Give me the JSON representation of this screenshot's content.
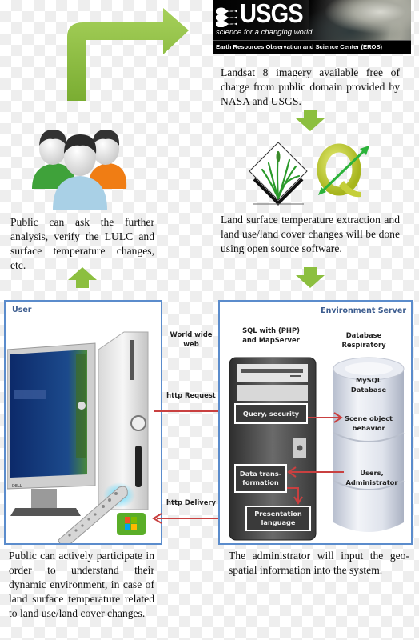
{
  "usgs_banner": {
    "wordmark": "USGS",
    "tagline": "science for a changing world",
    "center_name": "Earth Resources Observation and Science Center (EROS)"
  },
  "steps": {
    "landsat_text": "Landsat 8 imagery available free of charge from public domain provided by NASA and USGS.",
    "software_text": "Land surface temperature extraction and land use/land cover changes will be done using open source software.",
    "public_ask_text": "Public can ask the further analysis, verify the LULC and surface temperature changes, etc.",
    "public_participate_text": "Public can actively participate in order to understand their dynamic environment, in case of  land surface temperature related to land use/land cover changes.",
    "admin_text": "The administrator will input the geo-spatial information into the system."
  },
  "icons": {
    "users": "users-group-icon",
    "grass": "grass-gis-logo-icon",
    "qgis": "qgis-logo-icon",
    "computer": "desktop-computer-icon",
    "windows": "windows-media-center-icon",
    "server": "server-tower-icon",
    "database": "database-cylinder-icon"
  },
  "user_panel": {
    "title": "User"
  },
  "connections": {
    "www": "World wide web",
    "request": "http Request",
    "delivery": "http Delivery"
  },
  "server_panel": {
    "title": "Environment Server",
    "server_label": "SQL with (PHP) and MapServer",
    "db_label": "Database Respiratory",
    "boxes": {
      "query": "Query, security",
      "transform": "Data trans-formation",
      "presentation": "Presentation language"
    },
    "db_items": {
      "mysql": "MySQL Database",
      "scene": "Scene object behavior",
      "users": "Users, Administrator"
    }
  },
  "colors": {
    "arrow_green": "#8cbf3f",
    "panel_blue": "#5b8ccc",
    "flow_red": "#c94040",
    "title_blue": "#3d5d8f"
  }
}
